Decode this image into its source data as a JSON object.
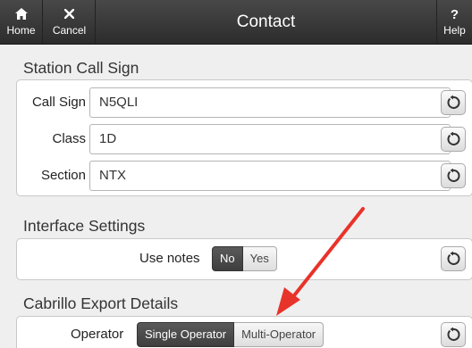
{
  "header": {
    "home_label": "Home",
    "cancel_label": "Cancel",
    "title": "Contact",
    "help_label": "Help",
    "help_glyph": "?",
    "home_icon": "home-icon",
    "cancel_icon": "close-icon"
  },
  "station": {
    "title": "Station Call Sign",
    "fields": [
      {
        "label": "Call Sign",
        "value": "N5QLI"
      },
      {
        "label": "Class",
        "value": "1D"
      },
      {
        "label": "Section",
        "value": "NTX"
      }
    ]
  },
  "interface": {
    "title": "Interface Settings",
    "use_notes_label": "Use notes",
    "options": [
      "No",
      "Yes"
    ],
    "selected": "No"
  },
  "cabrillo": {
    "title": "Cabrillo Export Details",
    "operator_label": "Operator",
    "options": [
      "Single Operator",
      "Multi-Operator"
    ],
    "selected": "Single Operator"
  },
  "colors": {
    "header_bg": "#2c2c2c",
    "active_segment": "#4a4a4a",
    "annotation_arrow": "#e8332a"
  }
}
